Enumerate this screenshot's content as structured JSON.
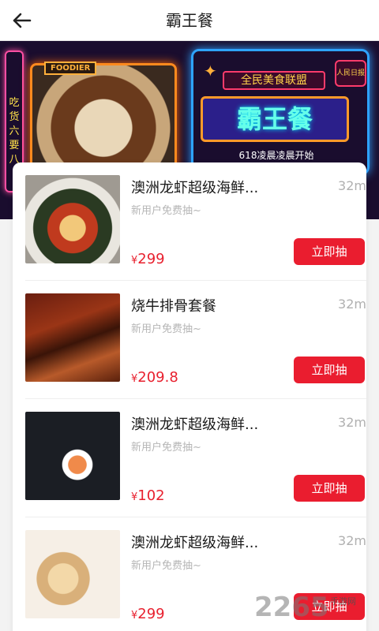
{
  "header": {
    "title": "霸王餐"
  },
  "banner": {
    "side_text": "吃货六要八",
    "photo_label": "FOODIER",
    "league": "全民美食联盟",
    "main_title": "霸王餐",
    "subline": "618凌晨凌晨开始",
    "badge": "人民日报"
  },
  "items": [
    {
      "name": "澳洲龙虾超级海鲜...",
      "distance": "32m",
      "subtitle": "新用户免费抽~",
      "currency": "¥",
      "price": "299",
      "button": "立即抽"
    },
    {
      "name": "烧牛排骨套餐",
      "distance": "32m",
      "subtitle": "新用户免费抽~",
      "currency": "¥",
      "price": "209.8",
      "button": "立即抽"
    },
    {
      "name": "澳洲龙虾超级海鲜...",
      "distance": "32m",
      "subtitle": "新用户免费抽~",
      "currency": "¥",
      "price": "102",
      "button": "立即抽"
    },
    {
      "name": "澳洲龙虾超级海鲜...",
      "distance": "32m",
      "subtitle": "新用户免费抽~",
      "currency": "¥",
      "price": "299",
      "button": "立即抽"
    }
  ],
  "watermark": {
    "number": "2265",
    "text": "手游网"
  },
  "colors": {
    "accent": "#ea1d2f",
    "price": "#e8202e"
  }
}
